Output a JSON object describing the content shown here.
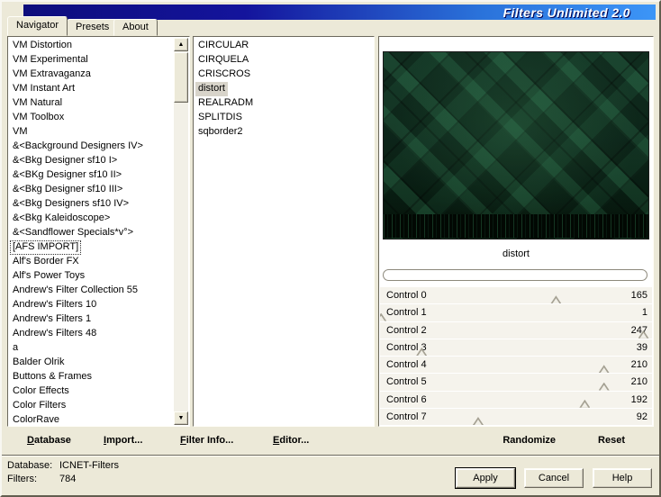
{
  "window": {
    "title": "Filters Unlimited 2.0"
  },
  "tabs": [
    {
      "label": "Navigator",
      "active": true
    },
    {
      "label": "Presets",
      "active": false
    },
    {
      "label": "About",
      "active": false
    }
  ],
  "categories": {
    "items": [
      "VM Distortion",
      "VM Experimental",
      "VM Extravaganza",
      "VM Instant Art",
      "VM Natural",
      "VM Toolbox",
      "VM",
      "&<Background Designers IV>",
      "&<Bkg Designer sf10 I>",
      "&<BKg Designer sf10 II>",
      "&<Bkg Designer sf10 III>",
      "&<Bkg Designers sf10 IV>",
      "&<Bkg Kaleidoscope>",
      "&<Sandflower Specials*v°>",
      "[AFS IMPORT]",
      "Alf's Border FX",
      "Alf's Power Toys",
      "Andrew's Filter Collection 55",
      "Andrew's Filters 10",
      "Andrew's Filters 1",
      "Andrew's Filters 48",
      "a",
      "Balder Olrik",
      "Buttons & Frames",
      "Color Effects",
      "Color Filters",
      "ColorRave"
    ],
    "selected_index": 14
  },
  "filters": {
    "items": [
      "CIRCULAR",
      "CIRQUELA",
      "CRISCROS",
      "distort",
      "REALRADM",
      "SPLITDIS",
      "sqborder2"
    ],
    "selected_index": 3
  },
  "preview": {
    "selected_filter": "distort"
  },
  "controls": [
    {
      "label": "Control 0",
      "value": 165
    },
    {
      "label": "Control 1",
      "value": 1
    },
    {
      "label": "Control 2",
      "value": 247
    },
    {
      "label": "Control 3",
      "value": 39
    },
    {
      "label": "Control 4",
      "value": 210
    },
    {
      "label": "Control 5",
      "value": 210
    },
    {
      "label": "Control 6",
      "value": 192
    },
    {
      "label": "Control 7",
      "value": 92
    }
  ],
  "toolbar": {
    "database": {
      "accel": "D",
      "rest": "atabase"
    },
    "import": {
      "accel": "I",
      "rest": "mport..."
    },
    "filter_info": {
      "accel": "F",
      "rest": "ilter Info..."
    },
    "editor": {
      "accel": "E",
      "rest": "ditor..."
    },
    "randomize": "Randomize",
    "reset": "Reset"
  },
  "status": {
    "database_label": "Database:",
    "database_value": "ICNET-Filters",
    "filters_label": "Filters:",
    "filters_value": "784"
  },
  "buttons": {
    "apply": "Apply",
    "cancel": "Cancel",
    "help": "Help"
  },
  "icons": {
    "scroll_up": "▲",
    "scroll_down": "▼"
  },
  "colors": {
    "dialog_bg": "#ece9d8",
    "title_grad_1": "#0d0d7c",
    "title_grad_2": "#3c95f7",
    "selection_bg": "#d8d4ca",
    "preview_base": "#0d2f20"
  }
}
